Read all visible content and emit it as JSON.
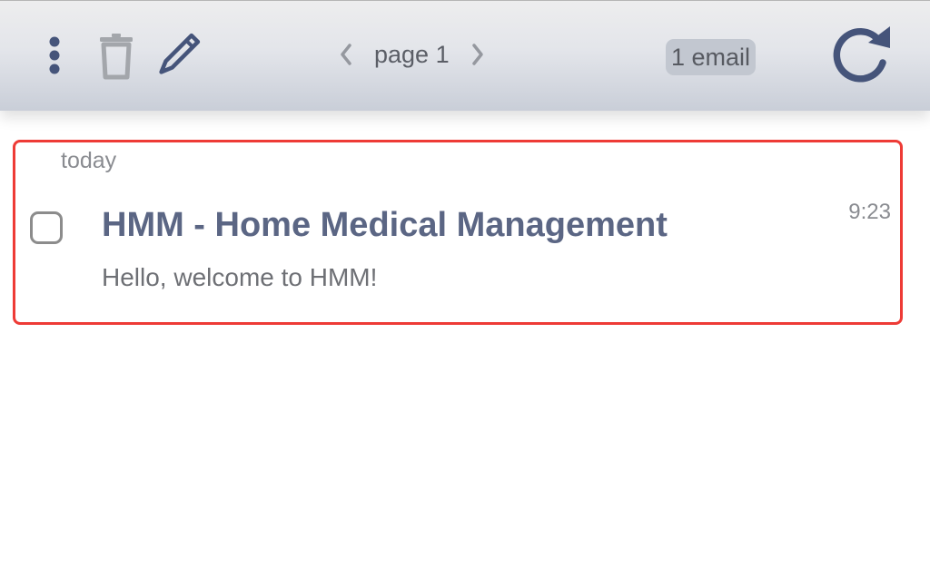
{
  "toolbar": {
    "menu_icon": "vertical-dots-icon",
    "delete_icon": "trash-icon",
    "compose_icon": "pencil-icon",
    "refresh_icon": "refresh-icon",
    "pager": {
      "prev_icon": "chevron-left-icon",
      "next_icon": "chevron-right-icon",
      "label": "page 1"
    },
    "email_count": "1 email"
  },
  "email_list": {
    "groups": [
      {
        "date_label": "today",
        "emails": [
          {
            "subject": "HMM - Home Medical Management",
            "preview": "Hello, welcome to HMM!",
            "time": "9:23",
            "selected": false
          }
        ]
      }
    ]
  },
  "colors": {
    "accent": "#45547a",
    "subject": "#5b6684",
    "highlight_border": "#ee3b36",
    "muted_icon": "#a3a6ab"
  }
}
